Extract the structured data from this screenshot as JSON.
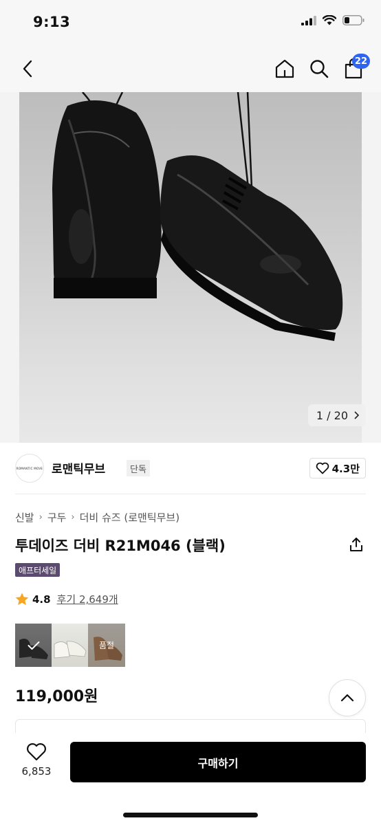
{
  "status_bar": {
    "time": "9:13"
  },
  "nav": {
    "cart_count": "22"
  },
  "gallery": {
    "counter": "1 / 20"
  },
  "brand": {
    "name": "로맨틱무브",
    "badge": "단독",
    "logo_text": "ROMANTIC MOVE",
    "likes": "4.3만"
  },
  "product": {
    "breadcrumb": [
      "신발",
      "구두",
      "더비 슈즈 (로맨틱무브)"
    ],
    "title": "투데이즈 더비 R21M046 (블랙)",
    "sale_tag": "애프터세일",
    "rating": "4.8",
    "reviews": "후기 2,649개",
    "price": "119,000원"
  },
  "options": {
    "soldout_label": "품절"
  },
  "bottom_bar": {
    "wish_count": "6,853",
    "buy_label": "구매하기"
  },
  "colors": {
    "accent": "#2f64f0",
    "star": "#f5a623",
    "sale_tag": "#5b4b6e",
    "buy_button": "#000000"
  }
}
